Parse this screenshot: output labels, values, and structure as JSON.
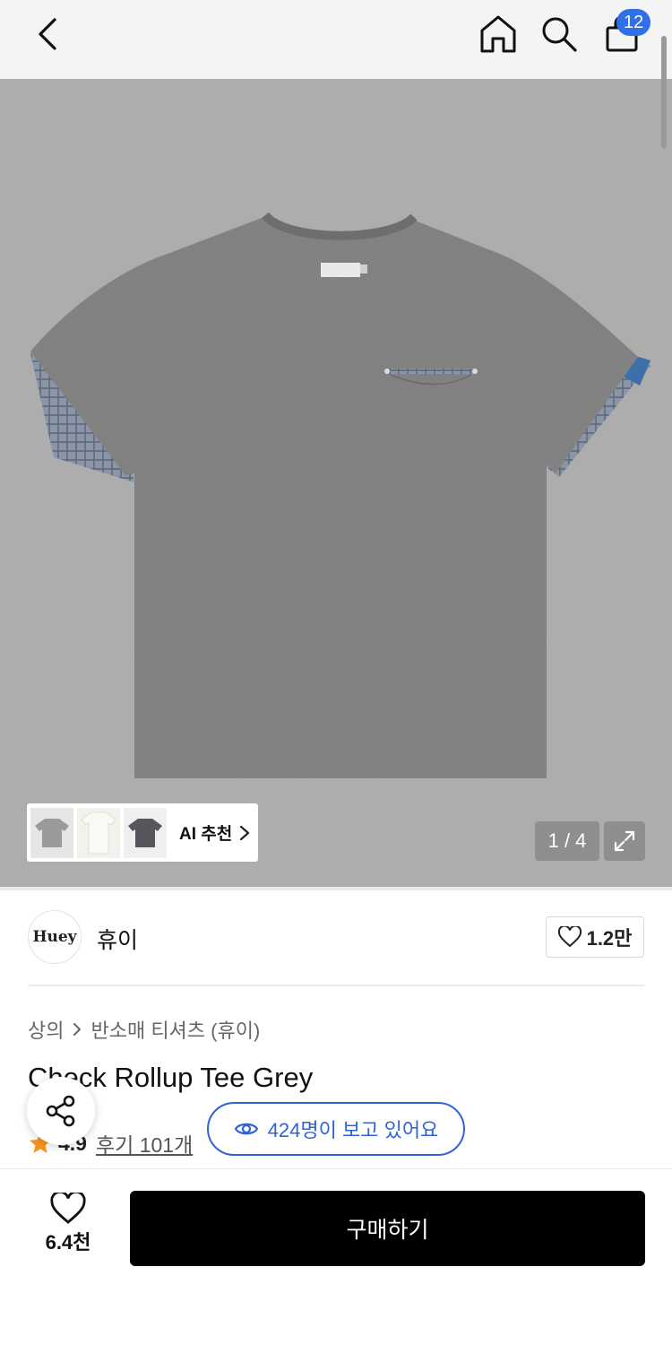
{
  "header": {
    "back_icon": "chevron-left-icon",
    "home_icon": "home-icon",
    "search_icon": "search-icon",
    "cart_icon": "shopping-bag-icon",
    "cart_badge": "12",
    "badge_color": "#2f6fe8"
  },
  "gallery": {
    "background_color": "#adadad",
    "ai_recommend_label": "AI 추천",
    "page_counter": "1 / 4",
    "expand_icon": "expand-icon"
  },
  "brand": {
    "logo_text": "Huey",
    "name": "휴이",
    "like_count": "1.2만",
    "like_icon": "heart-icon"
  },
  "product": {
    "breadcrumb": [
      "상의",
      "반소매 티셔츠 (휴이)"
    ],
    "title": "Check Rollup Tee Grey",
    "rating": "4.9",
    "review_link": "후기 101개",
    "viewers_text": "424명이 보고 있어요",
    "accent_color": "#2f64d8",
    "star_color": "#f7941d"
  },
  "bottom_bar": {
    "wish_count": "6.4천",
    "buy_label": "구매하기"
  }
}
